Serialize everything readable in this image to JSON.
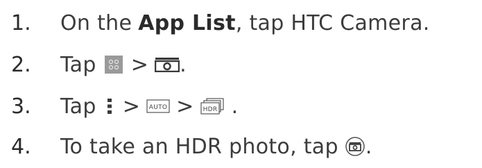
{
  "steps": [
    {
      "number": "1.",
      "text_before": "On the",
      "bold": "App List",
      "text_after": ", tap HTC Camera."
    },
    {
      "number": "2.",
      "text_before": "Tap",
      "separator": ">",
      "end": ".",
      "icons": [
        "camera-mode-grid-icon",
        "photo-camera-mode-icon"
      ]
    },
    {
      "number": "3.",
      "text_before": "Tap",
      "separator_1": ">",
      "separator_2": ">",
      "end": ".",
      "icon_labels": {
        "auto": "AUTO",
        "hdr": "HDR"
      },
      "icons": [
        "more-options-icon",
        "auto-scene-icon",
        "hdr-scene-icon"
      ]
    },
    {
      "number": "4.",
      "text": "To take an HDR photo, tap",
      "end": ".",
      "icons": [
        "shutter-button-icon"
      ]
    }
  ],
  "colors": {
    "text": "#3c3c3c",
    "number": "#2b2b2b",
    "icon_gray": "#9a9a9a",
    "icon_dark": "#3a3a3a"
  }
}
